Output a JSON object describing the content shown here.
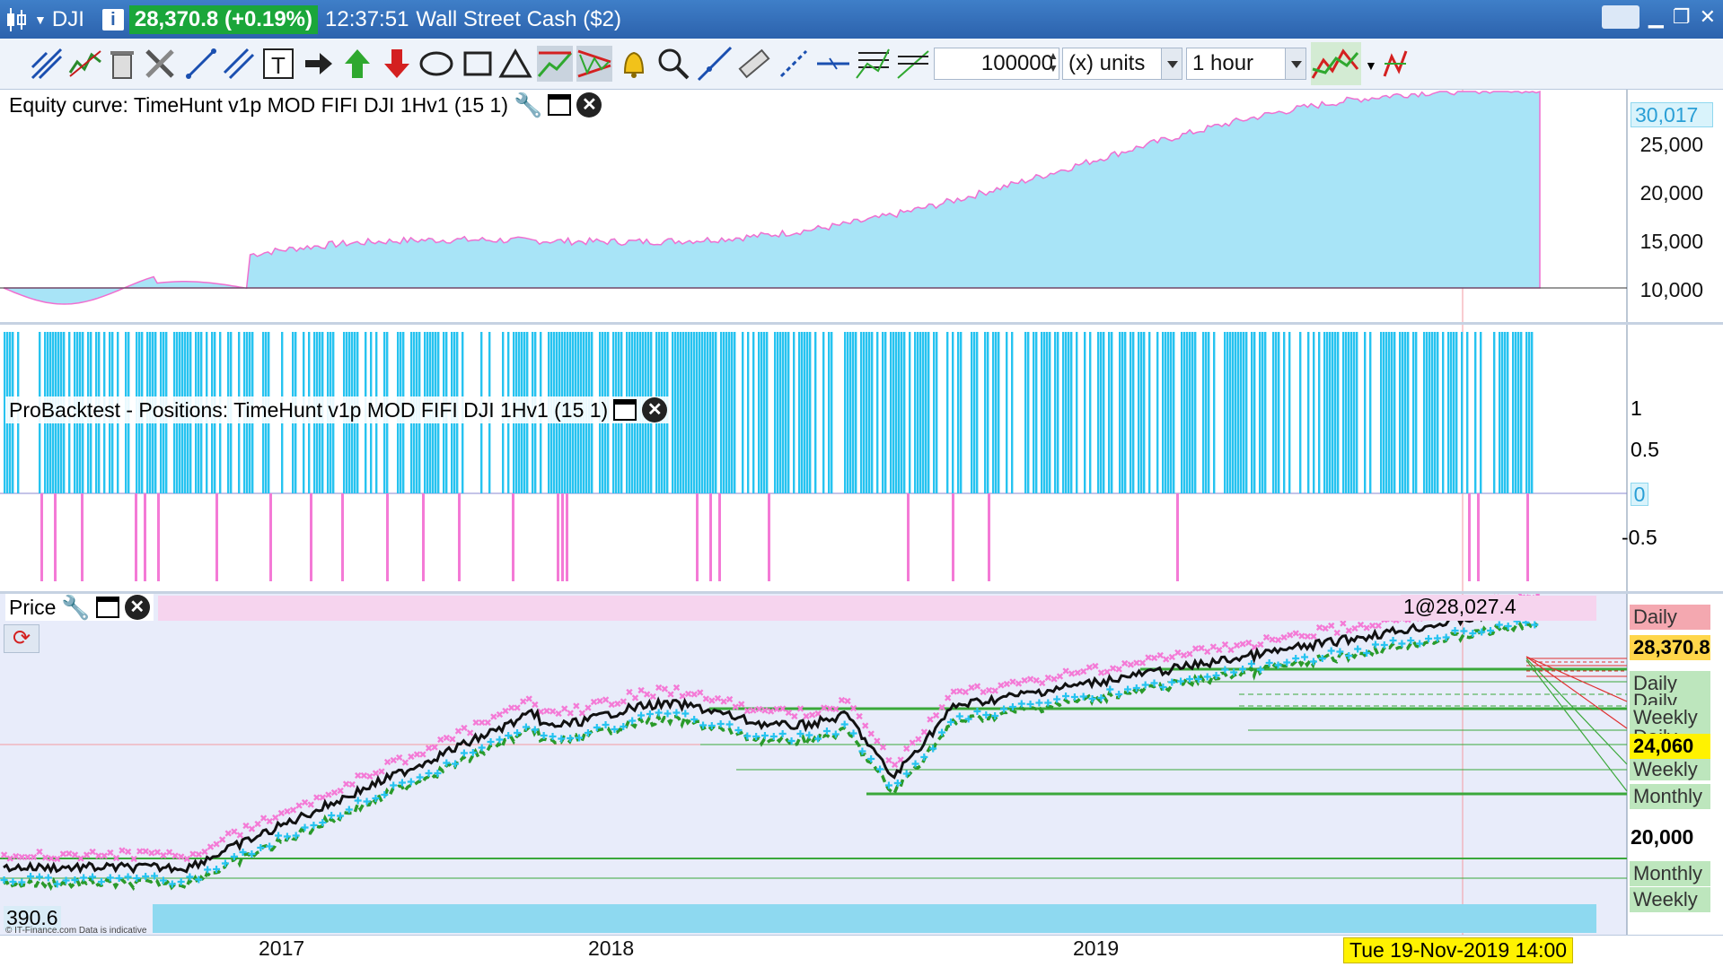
{
  "titlebar": {
    "symbol": "DJI",
    "price_change": "28,370.8 (+0.19%)",
    "clock": "12:37:51",
    "instrument": "Wall Street Cash ($2)"
  },
  "toolbar": {
    "quantity": "100000",
    "units": "(x) units",
    "timeframe": "1 hour"
  },
  "equity_panel": {
    "title": "Equity curve: TimeHunt v1p MOD FIFI DJI 1Hv1 (15 1)",
    "current_value": "30,017",
    "axis_labels": [
      "25,000",
      "20,000",
      "15,000",
      "10,000"
    ]
  },
  "positions_panel": {
    "title": "ProBacktest - Positions: TimeHunt v1p MOD FIFI DJI 1Hv1 (15 1)",
    "axis_labels": [
      "1",
      "0.5",
      "0",
      "-0.5"
    ]
  },
  "price_panel": {
    "title": "Price",
    "header_text": "1@28,027.4",
    "current_price": "28,370.8",
    "level_24060": "24,060",
    "level_20000": "20,000",
    "level_tag_top": "Daily",
    "tags": [
      "Daily",
      "Daily",
      "Weekly",
      "Daily",
      "Weekly",
      "Monthly",
      "Monthly",
      "Weekly"
    ],
    "bottom_left_value": "390.6",
    "footer_note": "© IT-Finance.com Data is indicative"
  },
  "time_axis": {
    "labels": [
      "2017",
      "2018",
      "2019"
    ],
    "cursor": "Tue 19-Nov-2019 14:00"
  },
  "colors": {
    "titlebar": "#2c62ad",
    "price_green": "#1aa63a",
    "equity_fill": "#a8e4f7",
    "long_bar": "#26c3f0",
    "short_bar": "#f47ad6",
    "level_line": "#3aa83a",
    "yellow_tag": "#fff200"
  }
}
